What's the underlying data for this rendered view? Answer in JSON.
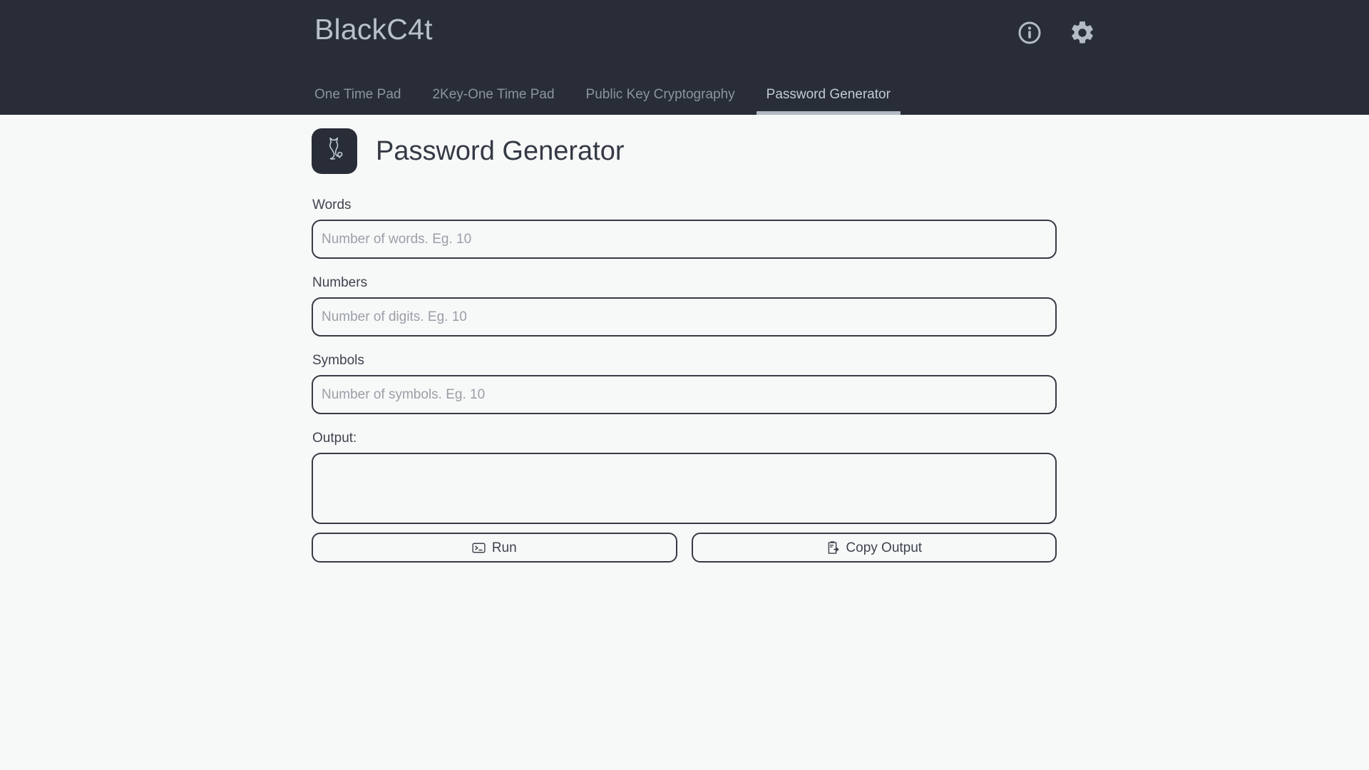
{
  "header": {
    "brand": "BlackC4t",
    "actions": [
      {
        "name": "info-icon",
        "label": "Info"
      },
      {
        "name": "gear-icon",
        "label": "Settings"
      }
    ],
    "tabs": [
      {
        "label": "One Time Pad",
        "active": false
      },
      {
        "label": "2Key-One Time Pad",
        "active": false
      },
      {
        "label": "Public Key Cryptography",
        "active": false
      },
      {
        "label": "Password Generator",
        "active": true
      }
    ]
  },
  "page": {
    "logo_icon": "cat-icon",
    "title": "Password Generator"
  },
  "form": {
    "words": {
      "label": "Words",
      "placeholder": "Number of words. Eg. 10",
      "value": ""
    },
    "numbers": {
      "label": "Numbers",
      "placeholder": "Number of digits. Eg. 10",
      "value": ""
    },
    "symbols": {
      "label": "Symbols",
      "placeholder": "Number of symbols. Eg. 10",
      "value": ""
    },
    "output": {
      "label": "Output:",
      "placeholder": "",
      "value": ""
    }
  },
  "buttons": {
    "run": {
      "label": "Run",
      "icon": "terminal-icon"
    },
    "copy": {
      "label": "Copy Output",
      "icon": "clipboard-copy-icon"
    }
  },
  "colors": {
    "header_bg": "#282d37",
    "page_bg": "#f7f8f8",
    "brand_text": "#b9c0cb",
    "tab_inactive": "#8d949f",
    "tab_active": "#c3cad4",
    "tab_underline": "#b2b9c5",
    "border": "#363b44",
    "body_text": "#3e444e",
    "placeholder": "#9aa0a8"
  }
}
